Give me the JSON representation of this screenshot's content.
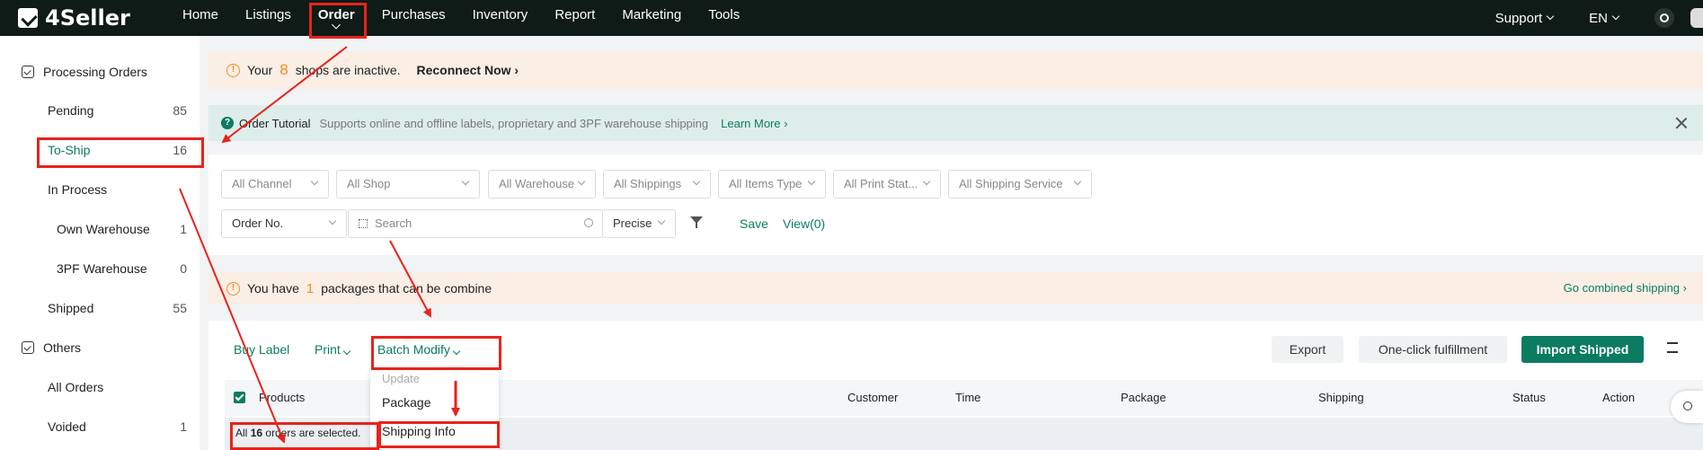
{
  "app": {
    "logo": "4Seller"
  },
  "nav": {
    "items": [
      "Home",
      "Listings",
      "Order",
      "Purchases",
      "Inventory",
      "Report",
      "Marketing",
      "Tools"
    ],
    "active": "Order",
    "support": "Support",
    "language": "EN"
  },
  "sidebar": {
    "processing_label": "Processing Orders",
    "items": [
      {
        "label": "Pending",
        "count": "85"
      },
      {
        "label": "To-Ship",
        "count": "16"
      },
      {
        "label": "In Process",
        "count": ""
      },
      {
        "label": "Own Warehouse",
        "count": "1"
      },
      {
        "label": "3PF Warehouse",
        "count": "0"
      },
      {
        "label": "Shipped",
        "count": "55"
      }
    ],
    "others_label": "Others",
    "other_items": [
      {
        "label": "All Orders",
        "count": ""
      },
      {
        "label": "Voided",
        "count": "1"
      }
    ]
  },
  "inactive_banner": {
    "prefix": "Your",
    "count": "8",
    "suffix": "shops are inactive.",
    "action": "Reconnect Now"
  },
  "tutorial": {
    "title": "Order Tutorial",
    "description": "Supports online and offline labels, proprietary and 3PF warehouse shipping",
    "link": "Learn More"
  },
  "filters": {
    "dropdowns": [
      "All Channel",
      "All Shop",
      "All Warehouse",
      "All Shippings",
      "All Items Type",
      "All Print Stat...",
      "All Shipping Service"
    ],
    "search_field": "Order No.",
    "search_placeholder": "Search",
    "match_mode": "Precise",
    "save": "Save",
    "view": "View(0)"
  },
  "combine_banner": {
    "prefix": "You have",
    "count": "1",
    "suffix": "packages that can be combine",
    "link": "Go combined shipping"
  },
  "toolbar": {
    "buy_label": "Buy Label",
    "print": "Print",
    "batch_modify": "Batch Modify",
    "export": "Export",
    "one_click": "One-click fulfillment",
    "import_shipped": "Import Shipped"
  },
  "batch_menu": {
    "header": "Update",
    "items": [
      "Package",
      "Shipping Info"
    ]
  },
  "table": {
    "columns": [
      "Products",
      "Customer",
      "Time",
      "Package",
      "Shipping",
      "Status",
      "Action"
    ]
  },
  "selection": {
    "prefix": "All",
    "count": "16",
    "suffix": "orders are selected."
  },
  "colors": {
    "primary": "#0b7b62",
    "warning": "#f08c22",
    "annotation": "#e8231c",
    "topbar": "#0e1b17"
  }
}
